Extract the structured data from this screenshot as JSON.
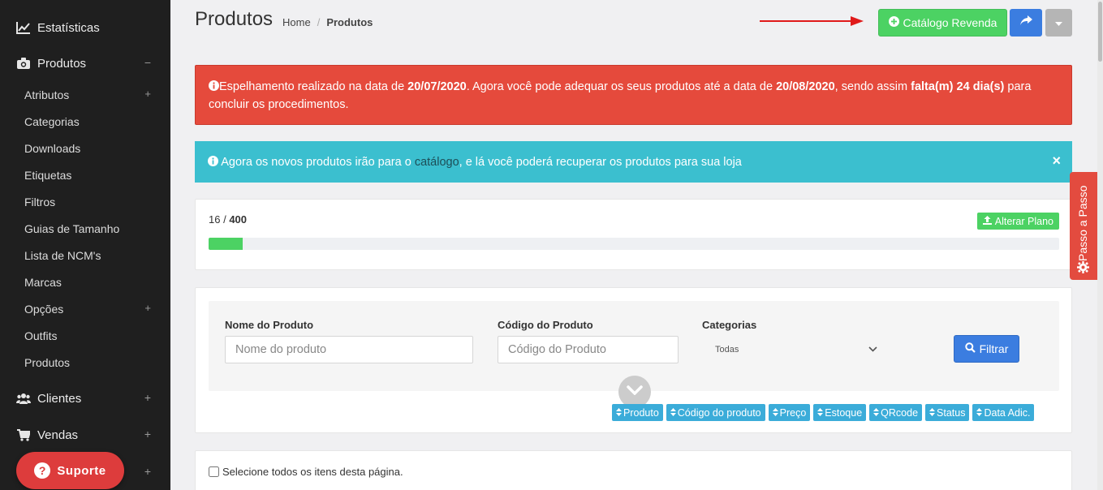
{
  "sidebar": {
    "top_items": [
      {
        "label": "Estatísticas",
        "icon": "chart-line-icon",
        "toggle": ""
      },
      {
        "label": "Produtos",
        "icon": "camera-icon",
        "toggle": "−"
      },
      {
        "label": "Clientes",
        "icon": "users-icon",
        "toggle": "+"
      },
      {
        "label": "Vendas",
        "icon": "cart-icon",
        "toggle": "+"
      }
    ],
    "sub_items": [
      {
        "label": "Atributos",
        "toggle": "+"
      },
      {
        "label": "Categorias",
        "toggle": ""
      },
      {
        "label": "Downloads",
        "toggle": ""
      },
      {
        "label": "Etiquetas",
        "toggle": ""
      },
      {
        "label": "Filtros",
        "toggle": ""
      },
      {
        "label": "Guias de Tamanho",
        "toggle": ""
      },
      {
        "label": "Lista de NCM's",
        "toggle": ""
      },
      {
        "label": "Marcas",
        "toggle": ""
      },
      {
        "label": "Opções",
        "toggle": "+"
      },
      {
        "label": "Outfits",
        "toggle": ""
      },
      {
        "label": "Produtos",
        "toggle": ""
      }
    ],
    "hidden_toggle": "+",
    "support_label": "Suporte"
  },
  "header": {
    "title": "Produtos",
    "breadcrumb": {
      "home": "Home",
      "separator": "/",
      "current": "Produtos"
    },
    "catalog_button": "Catálogo Revenda"
  },
  "alerts": {
    "red": {
      "t1": "Espelhamento realizado na data de ",
      "d1": "20/07/2020",
      "t2": ". Agora você pode adequar os seus produtos até a data de ",
      "d2": "20/08/2020",
      "t3": ", sendo assim ",
      "b3": "falta(m) 24 dia(s)",
      "t4": " para concluir os procedimentos."
    },
    "blue": {
      "t1": " Agora os novos produtos irão para o ",
      "link": "catálogo",
      "t2": ", e lá você poderá recuperar os produtos para sua loja",
      "close": "×"
    }
  },
  "plan": {
    "used": "16",
    "separator": " / ",
    "total": "400",
    "button": "Alterar Plano",
    "progress_fraction": 0.04
  },
  "filter": {
    "name_label": "Nome do Produto",
    "name_placeholder": "Nome do produto",
    "code_label": "Código do Produto",
    "code_placeholder": "Código do Produto",
    "category_label": "Categorias",
    "category_selected": "Todas",
    "button": "Filtrar"
  },
  "sort_buttons": [
    "Produto",
    "Código do produto",
    "Preço",
    "Estoque",
    "QRcode",
    "Status",
    "Data Adic."
  ],
  "list": {
    "select_all": "Selecione todos os itens desta página."
  },
  "side_tab": "Passo a Passo",
  "colors": {
    "sidebar_bg": "#1f1f1f",
    "success": "#4cd263",
    "primary": "#3b7de0",
    "danger": "#e54a3c",
    "info": "#3bbfcf",
    "sort": "#3bacd9"
  }
}
